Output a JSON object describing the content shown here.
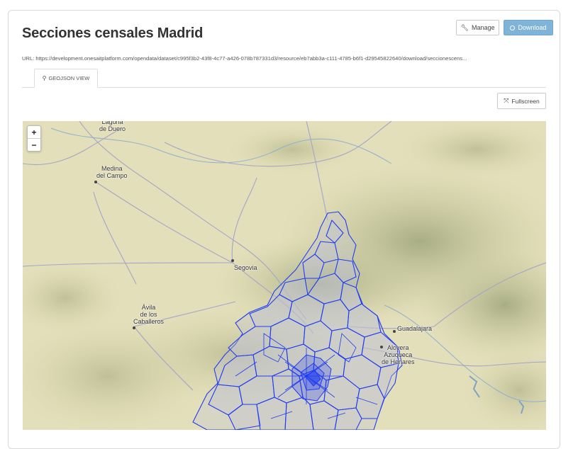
{
  "page": {
    "title": "Secciones censales Madrid",
    "manage_label": "Manage",
    "download_label": "Download",
    "url_text": "URL: https://development.onesaitplatform.com/opendata/dataset/c995f3b2-43f8-4c77-a426-078b787331d3/resource/eb7abb3a-c111-4785-b6f1-d29545822640/download/seccionescens...",
    "tab_label": "GEOJSON VIEW",
    "fullscreen_label": "Fullscreen"
  },
  "map": {
    "zoom_in": "+",
    "zoom_out": "−",
    "places": {
      "laguna": "Laguna\nde Duero",
      "medina": "Medina\ndel Campo",
      "segovia": "Segovia",
      "avila": "Ávila\nde los\nCaballeros",
      "guadalajara": "Guadalajara",
      "alovera": "Alovera\nAzuqueca\nde Henares"
    },
    "overlay_color": "#1f3cf2"
  }
}
